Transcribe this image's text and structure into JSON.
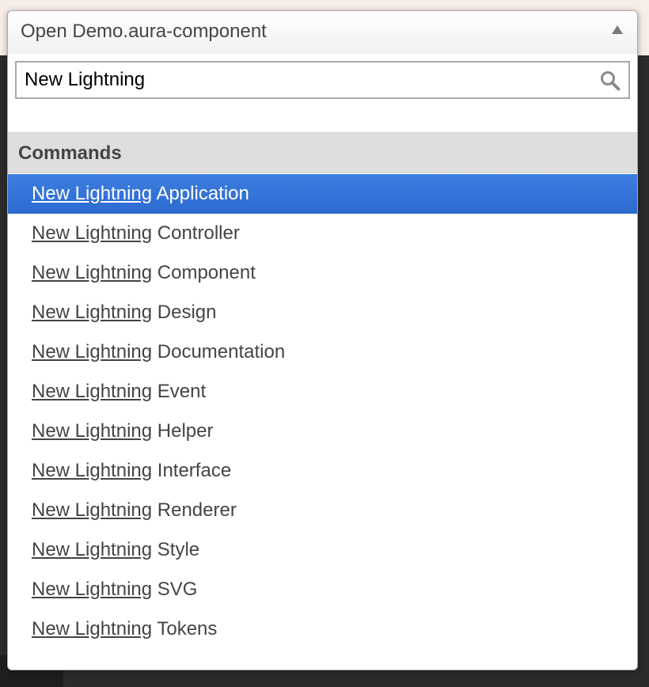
{
  "dropdown": {
    "title": "Open Demo.aura-component",
    "caret_icon": "triangle-up-icon"
  },
  "search": {
    "value": "New Lightning",
    "icon": "search-icon"
  },
  "section": {
    "label": "Commands"
  },
  "commands": [
    {
      "match": "New Lightning",
      "rest": " Application",
      "selected": true
    },
    {
      "match": "New Lightning",
      "rest": " Controller",
      "selected": false
    },
    {
      "match": "New Lightning",
      "rest": " Component",
      "selected": false
    },
    {
      "match": "New Lightning",
      "rest": " Design",
      "selected": false
    },
    {
      "match": "New Lightning",
      "rest": " Documentation",
      "selected": false
    },
    {
      "match": "New Lightning",
      "rest": " Event",
      "selected": false
    },
    {
      "match": "New Lightning",
      "rest": " Helper",
      "selected": false
    },
    {
      "match": "New Lightning",
      "rest": " Interface",
      "selected": false
    },
    {
      "match": "New Lightning",
      "rest": " Renderer",
      "selected": false
    },
    {
      "match": "New Lightning",
      "rest": " Style",
      "selected": false
    },
    {
      "match": "New Lightning",
      "rest": " SVG",
      "selected": false
    },
    {
      "match": "New Lightning",
      "rest": " Tokens",
      "selected": false
    }
  ],
  "colors": {
    "selection": "#3d7ee0",
    "section_bg": "#dedede",
    "text": "#444444"
  }
}
